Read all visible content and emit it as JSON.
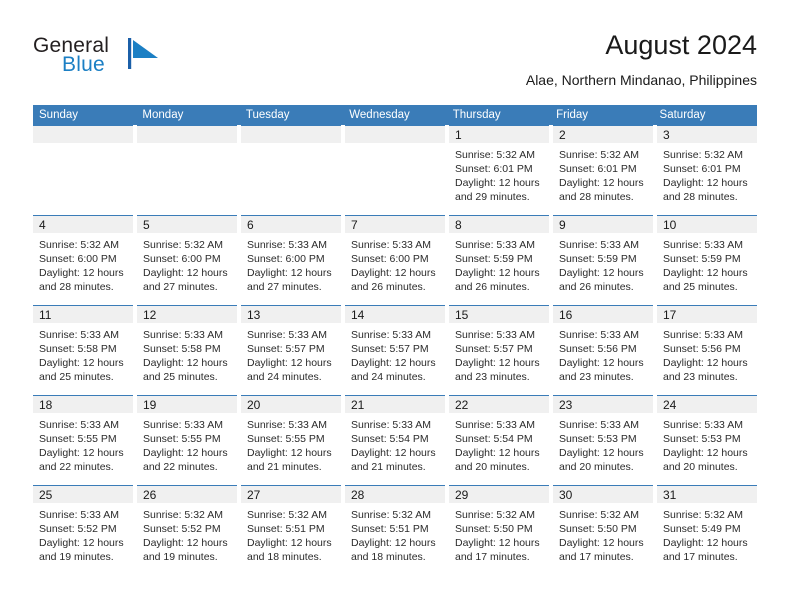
{
  "brand": {
    "word_general": "General",
    "word_blue": "Blue",
    "mark_color": "#1b7fc4"
  },
  "header": {
    "title": "August 2024",
    "subtitle": "Alae, Northern Mindanao, Philippines"
  },
  "colors": {
    "header_blue": "#3a7cb8",
    "cell_header_gray": "#f0f0f0",
    "text": "#1a1a1a"
  },
  "weekdays": [
    "Sunday",
    "Monday",
    "Tuesday",
    "Wednesday",
    "Thursday",
    "Friday",
    "Saturday"
  ],
  "weeks": [
    [
      {
        "day": "",
        "lines": []
      },
      {
        "day": "",
        "lines": []
      },
      {
        "day": "",
        "lines": []
      },
      {
        "day": "",
        "lines": []
      },
      {
        "day": "1",
        "lines": [
          "Sunrise: 5:32 AM",
          "Sunset: 6:01 PM",
          "Daylight: 12 hours",
          "and 29 minutes."
        ]
      },
      {
        "day": "2",
        "lines": [
          "Sunrise: 5:32 AM",
          "Sunset: 6:01 PM",
          "Daylight: 12 hours",
          "and 28 minutes."
        ]
      },
      {
        "day": "3",
        "lines": [
          "Sunrise: 5:32 AM",
          "Sunset: 6:01 PM",
          "Daylight: 12 hours",
          "and 28 minutes."
        ]
      }
    ],
    [
      {
        "day": "4",
        "lines": [
          "Sunrise: 5:32 AM",
          "Sunset: 6:00 PM",
          "Daylight: 12 hours",
          "and 28 minutes."
        ]
      },
      {
        "day": "5",
        "lines": [
          "Sunrise: 5:32 AM",
          "Sunset: 6:00 PM",
          "Daylight: 12 hours",
          "and 27 minutes."
        ]
      },
      {
        "day": "6",
        "lines": [
          "Sunrise: 5:33 AM",
          "Sunset: 6:00 PM",
          "Daylight: 12 hours",
          "and 27 minutes."
        ]
      },
      {
        "day": "7",
        "lines": [
          "Sunrise: 5:33 AM",
          "Sunset: 6:00 PM",
          "Daylight: 12 hours",
          "and 26 minutes."
        ]
      },
      {
        "day": "8",
        "lines": [
          "Sunrise: 5:33 AM",
          "Sunset: 5:59 PM",
          "Daylight: 12 hours",
          "and 26 minutes."
        ]
      },
      {
        "day": "9",
        "lines": [
          "Sunrise: 5:33 AM",
          "Sunset: 5:59 PM",
          "Daylight: 12 hours",
          "and 26 minutes."
        ]
      },
      {
        "day": "10",
        "lines": [
          "Sunrise: 5:33 AM",
          "Sunset: 5:59 PM",
          "Daylight: 12 hours",
          "and 25 minutes."
        ]
      }
    ],
    [
      {
        "day": "11",
        "lines": [
          "Sunrise: 5:33 AM",
          "Sunset: 5:58 PM",
          "Daylight: 12 hours",
          "and 25 minutes."
        ]
      },
      {
        "day": "12",
        "lines": [
          "Sunrise: 5:33 AM",
          "Sunset: 5:58 PM",
          "Daylight: 12 hours",
          "and 25 minutes."
        ]
      },
      {
        "day": "13",
        "lines": [
          "Sunrise: 5:33 AM",
          "Sunset: 5:57 PM",
          "Daylight: 12 hours",
          "and 24 minutes."
        ]
      },
      {
        "day": "14",
        "lines": [
          "Sunrise: 5:33 AM",
          "Sunset: 5:57 PM",
          "Daylight: 12 hours",
          "and 24 minutes."
        ]
      },
      {
        "day": "15",
        "lines": [
          "Sunrise: 5:33 AM",
          "Sunset: 5:57 PM",
          "Daylight: 12 hours",
          "and 23 minutes."
        ]
      },
      {
        "day": "16",
        "lines": [
          "Sunrise: 5:33 AM",
          "Sunset: 5:56 PM",
          "Daylight: 12 hours",
          "and 23 minutes."
        ]
      },
      {
        "day": "17",
        "lines": [
          "Sunrise: 5:33 AM",
          "Sunset: 5:56 PM",
          "Daylight: 12 hours",
          "and 23 minutes."
        ]
      }
    ],
    [
      {
        "day": "18",
        "lines": [
          "Sunrise: 5:33 AM",
          "Sunset: 5:55 PM",
          "Daylight: 12 hours",
          "and 22 minutes."
        ]
      },
      {
        "day": "19",
        "lines": [
          "Sunrise: 5:33 AM",
          "Sunset: 5:55 PM",
          "Daylight: 12 hours",
          "and 22 minutes."
        ]
      },
      {
        "day": "20",
        "lines": [
          "Sunrise: 5:33 AM",
          "Sunset: 5:55 PM",
          "Daylight: 12 hours",
          "and 21 minutes."
        ]
      },
      {
        "day": "21",
        "lines": [
          "Sunrise: 5:33 AM",
          "Sunset: 5:54 PM",
          "Daylight: 12 hours",
          "and 21 minutes."
        ]
      },
      {
        "day": "22",
        "lines": [
          "Sunrise: 5:33 AM",
          "Sunset: 5:54 PM",
          "Daylight: 12 hours",
          "and 20 minutes."
        ]
      },
      {
        "day": "23",
        "lines": [
          "Sunrise: 5:33 AM",
          "Sunset: 5:53 PM",
          "Daylight: 12 hours",
          "and 20 minutes."
        ]
      },
      {
        "day": "24",
        "lines": [
          "Sunrise: 5:33 AM",
          "Sunset: 5:53 PM",
          "Daylight: 12 hours",
          "and 20 minutes."
        ]
      }
    ],
    [
      {
        "day": "25",
        "lines": [
          "Sunrise: 5:33 AM",
          "Sunset: 5:52 PM",
          "Daylight: 12 hours",
          "and 19 minutes."
        ]
      },
      {
        "day": "26",
        "lines": [
          "Sunrise: 5:32 AM",
          "Sunset: 5:52 PM",
          "Daylight: 12 hours",
          "and 19 minutes."
        ]
      },
      {
        "day": "27",
        "lines": [
          "Sunrise: 5:32 AM",
          "Sunset: 5:51 PM",
          "Daylight: 12 hours",
          "and 18 minutes."
        ]
      },
      {
        "day": "28",
        "lines": [
          "Sunrise: 5:32 AM",
          "Sunset: 5:51 PM",
          "Daylight: 12 hours",
          "and 18 minutes."
        ]
      },
      {
        "day": "29",
        "lines": [
          "Sunrise: 5:32 AM",
          "Sunset: 5:50 PM",
          "Daylight: 12 hours",
          "and 17 minutes."
        ]
      },
      {
        "day": "30",
        "lines": [
          "Sunrise: 5:32 AM",
          "Sunset: 5:50 PM",
          "Daylight: 12 hours",
          "and 17 minutes."
        ]
      },
      {
        "day": "31",
        "lines": [
          "Sunrise: 5:32 AM",
          "Sunset: 5:49 PM",
          "Daylight: 12 hours",
          "and 17 minutes."
        ]
      }
    ]
  ]
}
